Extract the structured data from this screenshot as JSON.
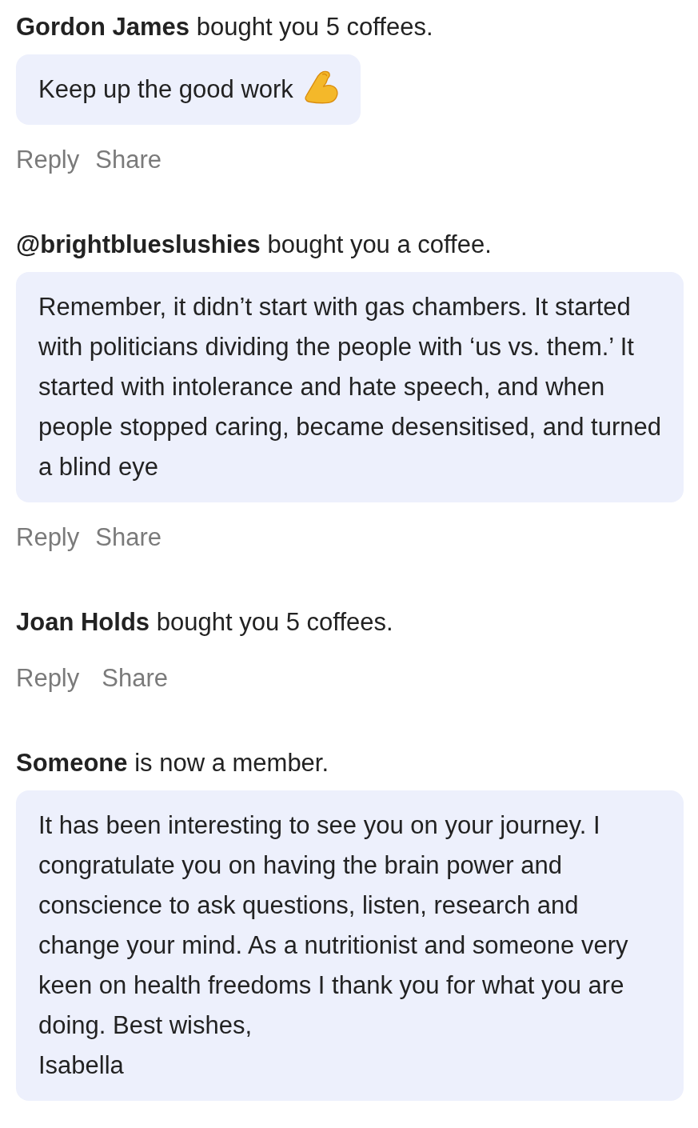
{
  "feed": [
    {
      "name": "Gordon James",
      "action": "bought you 5 coffees.",
      "message": "Keep up the good work",
      "trailing_emoji": true,
      "actions": [
        "Reply",
        "Share"
      ]
    },
    {
      "name": "@brightblueslushies",
      "action": "bought you a coffee.",
      "message": "Remember, it didn’t start with gas chambers. It started with politicians dividing the people with ‘us vs. them.’ It started with intolerance and hate speech, and when people stopped caring, became desensitised, and turned a blind eye",
      "actions": [
        "Reply",
        "Share"
      ]
    },
    {
      "name": "Joan Holds",
      "action": "bought you 5 coffees.",
      "actions": [
        "Reply",
        "Share"
      ]
    },
    {
      "name": "Someone",
      "action": "is now a member.",
      "message": "It has been interesting to see you on your journey. I congratulate you on having the brain power and conscience to ask questions, listen, research and change your mind. As a nutritionist and someone very keen on health freedoms I thank you for what you are doing. Best wishes,\nIsabella"
    }
  ]
}
